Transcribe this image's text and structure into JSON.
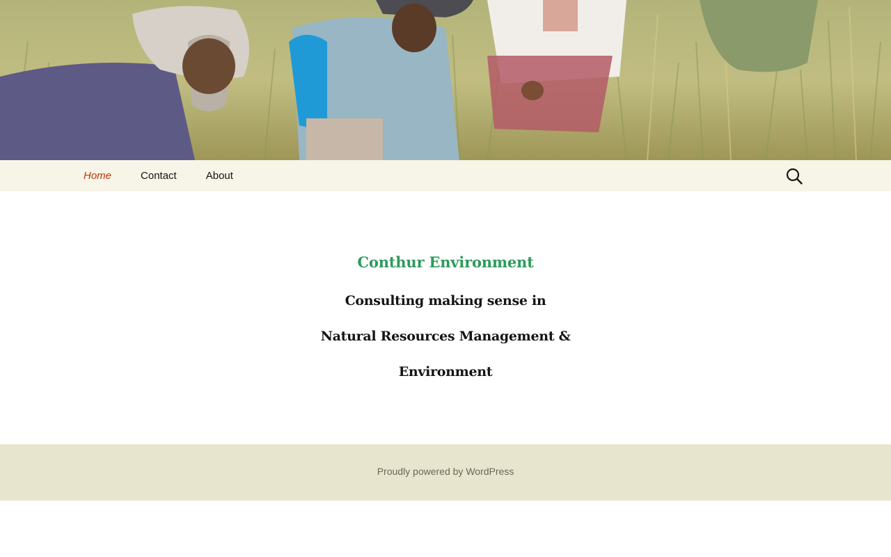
{
  "header": {
    "image": "rice-harvest-workers-photo"
  },
  "nav": {
    "items": [
      {
        "label": "Home",
        "current": true
      },
      {
        "label": "Contact",
        "current": false
      },
      {
        "label": "About",
        "current": false
      }
    ],
    "search_icon": "search-icon"
  },
  "main": {
    "heading": "Conthur Environment",
    "tagline_lines": [
      "Consulting making sense in",
      "Natural Resources Management &",
      "Environment"
    ]
  },
  "footer": {
    "credit": "Proudly powered by WordPress"
  },
  "colors": {
    "navbar_bg": "#f7f5e7",
    "nav_current": "#bc360a",
    "heading": "#2e9a5e",
    "footer_bg": "#e8e5ce",
    "footer_text": "#686758"
  }
}
